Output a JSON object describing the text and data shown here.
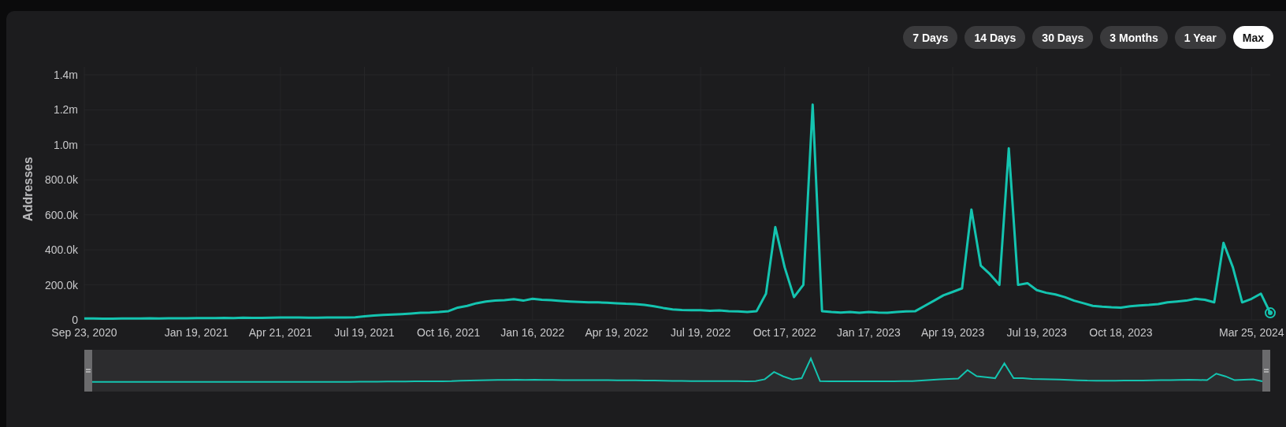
{
  "ranges": [
    {
      "label": "7 Days",
      "selected": false
    },
    {
      "label": "14 Days",
      "selected": false
    },
    {
      "label": "30 Days",
      "selected": false
    },
    {
      "label": "3 Months",
      "selected": false
    },
    {
      "label": "1 Year",
      "selected": false
    },
    {
      "label": "Max",
      "selected": true
    }
  ],
  "chart": {
    "chart_data": {
      "type": "line",
      "ylabel": "Addresses",
      "categories": [
        "Sep 23, 2020",
        null,
        null,
        null,
        null,
        null,
        null,
        null,
        null,
        null,
        null,
        null,
        "Jan 19, 2021",
        null,
        null,
        null,
        null,
        null,
        null,
        null,
        null,
        "Apr 21, 2021",
        null,
        null,
        null,
        null,
        null,
        null,
        null,
        null,
        "Jul 19, 2021",
        null,
        null,
        null,
        null,
        null,
        null,
        null,
        null,
        "Oct 16, 2021",
        null,
        null,
        null,
        null,
        null,
        null,
        null,
        null,
        "Jan 16, 2022",
        null,
        null,
        null,
        null,
        null,
        null,
        null,
        null,
        "Apr 19, 2022",
        null,
        null,
        null,
        null,
        null,
        null,
        null,
        null,
        "Jul 19, 2022",
        null,
        null,
        null,
        null,
        null,
        null,
        null,
        null,
        "Oct 17, 2022",
        null,
        null,
        null,
        null,
        null,
        null,
        null,
        null,
        "Jan 17, 2023",
        null,
        null,
        null,
        null,
        null,
        null,
        null,
        null,
        "Apr 19, 2023",
        null,
        null,
        null,
        null,
        null,
        null,
        null,
        null,
        "Jul 19, 2023",
        null,
        null,
        null,
        null,
        null,
        null,
        null,
        null,
        "Oct 18, 2023",
        null,
        null,
        null,
        null,
        null,
        null,
        null,
        null,
        null,
        null,
        null,
        null,
        null,
        "Mar 25, 2024",
        null,
        null
      ],
      "series": [
        {
          "color": "#14c4b0",
          "values": [
            8000,
            8000,
            7000,
            7000,
            8000,
            8000,
            8000,
            9000,
            8000,
            9000,
            9000,
            9000,
            10000,
            10000,
            10000,
            11000,
            10000,
            12000,
            11000,
            11000,
            12000,
            13000,
            13000,
            14000,
            12000,
            12000,
            13000,
            13000,
            14000,
            15000,
            20000,
            25000,
            28000,
            30000,
            33000,
            36000,
            40000,
            42000,
            45000,
            50000,
            70000,
            80000,
            95000,
            105000,
            110000,
            112000,
            118000,
            110000,
            120000,
            115000,
            112000,
            108000,
            105000,
            102000,
            100000,
            100000,
            98000,
            95000,
            92000,
            90000,
            85000,
            78000,
            68000,
            60000,
            56000,
            55000,
            55000,
            52000,
            54000,
            50000,
            48000,
            45000,
            50000,
            150000,
            530000,
            300000,
            130000,
            200000,
            1230000,
            50000,
            45000,
            42000,
            45000,
            40000,
            45000,
            42000,
            40000,
            45000,
            48000,
            50000,
            80000,
            110000,
            140000,
            160000,
            180000,
            630000,
            310000,
            260000,
            200000,
            980000,
            200000,
            210000,
            170000,
            155000,
            145000,
            130000,
            110000,
            95000,
            80000,
            75000,
            72000,
            70000,
            78000,
            82000,
            85000,
            90000,
            100000,
            105000,
            110000,
            120000,
            115000,
            100000,
            440000,
            300000,
            100000,
            120000,
            150000,
            40000
          ]
        }
      ],
      "ylim": [
        0,
        1400000
      ],
      "grid": true,
      "yticks": [
        {
          "value": 0,
          "label": "0"
        },
        {
          "value": 200000,
          "label": "200.0k"
        },
        {
          "value": 400000,
          "label": "400.0k"
        },
        {
          "value": 600000,
          "label": "600.0k"
        },
        {
          "value": 800000,
          "label": "800.0k"
        },
        {
          "value": 1000000,
          "label": "1.0m"
        },
        {
          "value": 1200000,
          "label": "1.2m"
        },
        {
          "value": 1400000,
          "label": "1.4m"
        }
      ]
    }
  }
}
